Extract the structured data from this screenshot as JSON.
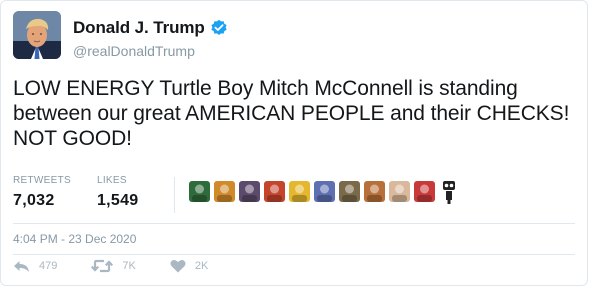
{
  "tweet": {
    "display_name": "Donald J. Trump",
    "handle": "@realDonaldTrump",
    "verified": true,
    "avatar_icon": "profile-photo",
    "text": "LOW ENERGY Turtle Boy Mitch McConnell is standing between our great AMERICAN PEOPLE and their CHECKS! NOT GOOD!",
    "timestamp": "4:04 PM - 23 Dec 2020"
  },
  "stats": {
    "retweets_label": "RETWEETS",
    "retweets_value": "7,032",
    "likes_label": "LIKES",
    "likes_value": "1,549"
  },
  "likers": [
    {
      "name": "liker-avatar-1",
      "color": "#2f6b3a"
    },
    {
      "name": "liker-avatar-2",
      "color": "#d08a2a"
    },
    {
      "name": "liker-avatar-3",
      "color": "#5b4a6b"
    },
    {
      "name": "liker-avatar-4",
      "color": "#c4442c"
    },
    {
      "name": "liker-avatar-5",
      "color": "#e5b72f"
    },
    {
      "name": "liker-avatar-6",
      "color": "#5e6fb2"
    },
    {
      "name": "liker-avatar-7",
      "color": "#7a6a4a"
    },
    {
      "name": "liker-avatar-8",
      "color": "#b8703a"
    },
    {
      "name": "liker-avatar-9",
      "color": "#d9b89c"
    },
    {
      "name": "liker-avatar-10",
      "color": "#c83a3a"
    }
  ],
  "actions": {
    "reply_count": "479",
    "retweet_count": "7K",
    "like_count": "2K"
  },
  "colors": {
    "text": "#14171a",
    "muted": "#8899a6",
    "verified_blue": "#1da1f2",
    "action_gray": "#aab8c2",
    "divider": "#e1e8ed"
  }
}
